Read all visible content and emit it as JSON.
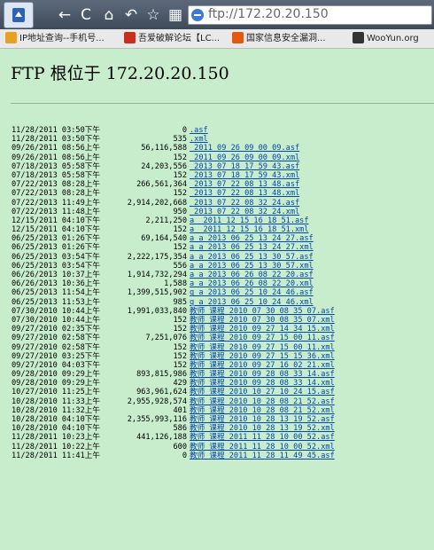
{
  "toolbar": {
    "back": "←",
    "reload": "C",
    "home": "⌂",
    "undo": "↶",
    "favorite": "☆",
    "apps": "▦",
    "url": "ftp://172.20.20.150"
  },
  "bookmarks": [
    {
      "label": "IP地址查询--手机号...",
      "color": "#e8a020"
    },
    {
      "label": "吾爱破解论坛【LC...",
      "color": "#c8301c"
    },
    {
      "label": "国家信息安全漏洞...",
      "color": "#e05a10"
    },
    {
      "label": "WooYun.org",
      "color": "#333333"
    }
  ],
  "heading": "FTP 根位于 172.20.20.150",
  "entries": [
    {
      "date": "11/28/2011 03:50下午",
      "size": "0",
      "name": ".asf"
    },
    {
      "date": "11/28/2011 03:50下午",
      "size": "535",
      "name": ".xml"
    },
    {
      "date": "09/26/2011 08:56上午",
      "size": "56,116,588",
      "name": "_2011_09_26_09_00_09.asf"
    },
    {
      "date": "09/26/2011 08:56上午",
      "size": "152",
      "name": "_2011_09_26_09_00_09.xml"
    },
    {
      "date": "07/18/2013 05:58下午",
      "size": "24,203,556",
      "name": "_2013_07_18_17_59_43.asf"
    },
    {
      "date": "07/18/2013 05:58下午",
      "size": "152",
      "name": "_2013_07_18_17_59_43.xml"
    },
    {
      "date": "07/22/2013 08:28上午",
      "size": "266,561,364",
      "name": "_2013_07_22_08_13_48.asf"
    },
    {
      "date": "07/22/2013 08:28上午",
      "size": "152",
      "name": "_2013_07_22_08_13_48.xml"
    },
    {
      "date": "07/22/2013 11:49上午",
      "size": "2,914,202,668",
      "name": "_2013_07_22_08_32_24.asf"
    },
    {
      "date": "07/22/2013 11:48上午",
      "size": "950",
      "name": "_2013_07_22_08_32_24.xml"
    },
    {
      "date": "12/15/2011 04:10下午",
      "size": "2,211,250",
      "name": "a__2011_12_15_16_18_51.asf"
    },
    {
      "date": "12/15/2011 04:10下午",
      "size": "152",
      "name": "a__2011_12_15_16_18_51.xml"
    },
    {
      "date": "06/25/2013 01:26下午",
      "size": "69,164,540",
      "name": "a_a_2013_06_25_13_24_27.asf"
    },
    {
      "date": "06/25/2013 01:26下午",
      "size": "152",
      "name": "a_a_2013_06_25_13_24_27.xml"
    },
    {
      "date": "06/25/2013 03:54下午",
      "size": "2,222,175,354",
      "name": "a_a_2013_06_25_13_30_57.asf"
    },
    {
      "date": "06/25/2013 03:54下午",
      "size": "556",
      "name": "a_a_2013_06_25_13_30_57.xml"
    },
    {
      "date": "06/26/2013 10:37上午",
      "size": "1,914,732,294",
      "name": "a_a_2013_06_26_08_22_20.asf"
    },
    {
      "date": "06/26/2013 10:36上午",
      "size": "1,588",
      "name": "a_a_2013_06_26_08_22_20.xml"
    },
    {
      "date": "06/25/2013 11:54上午",
      "size": "1,399,515,902",
      "name": "q_a_2013_06_25_10_24_46.asf"
    },
    {
      "date": "06/25/2013 11:53上午",
      "size": "985",
      "name": "q_a_2013_06_25_10_24_46.xml"
    },
    {
      "date": "07/30/2010 10:44上午",
      "size": "1,991,033,840",
      "name": "教师_课程_2010_07_30_08_35_07.asf"
    },
    {
      "date": "07/30/2010 10:44上午",
      "size": "152",
      "name": "教师_课程_2010_07_30_08_35_07.xml"
    },
    {
      "date": "09/27/2010 02:35下午",
      "size": "152",
      "name": "教师_课程_2010_09_27_14_34_15.xml"
    },
    {
      "date": "09/27/2010 02:58下午",
      "size": "7,251,076",
      "name": "教师_课程_2010_09_27_15_00_11.asf"
    },
    {
      "date": "09/27/2010 02:58下午",
      "size": "152",
      "name": "教师_课程_2010_09_27_15_00_11.xml"
    },
    {
      "date": "09/27/2010 03:25下午",
      "size": "152",
      "name": "教师_课程_2010_09_27_15_15_36.xml"
    },
    {
      "date": "09/27/2010 04:03下午",
      "size": "152",
      "name": "教师_课程_2010_09_27_16_02_21.xml"
    },
    {
      "date": "09/28/2010 09:29上午",
      "size": "893,815,986",
      "name": "教师_课程_2010_09_28_08_33_14.asf"
    },
    {
      "date": "09/28/2010 09:29上午",
      "size": "429",
      "name": "教师_课程_2010_09_28_08_33_14.xml"
    },
    {
      "date": "10/27/2010 11:25上午",
      "size": "963,961,624",
      "name": "教师_课程_2010_10_27_10_24_15.asf"
    },
    {
      "date": "10/28/2010 11:33上午",
      "size": "2,955,928,574",
      "name": "教师_课程_2010_10_28_08_21_52.asf"
    },
    {
      "date": "10/28/2010 11:32上午",
      "size": "401",
      "name": "教师_课程_2010_10_28_08_21_52.xml"
    },
    {
      "date": "10/28/2010 04:10下午",
      "size": "2,355,993,116",
      "name": "教师_课程_2010_10_28_13_19_52.asf"
    },
    {
      "date": "10/28/2010 04:10下午",
      "size": "586",
      "name": "教师_课程_2010_10_28_13_19_52.xml"
    },
    {
      "date": "11/28/2011 10:23上午",
      "size": "441,126,188",
      "name": "教师_课程_2011_11_28_10_00_52.asf"
    },
    {
      "date": "11/28/2011 10:22上午",
      "size": "600",
      "name": "教师_课程_2011_11_28_10_00_52.xml"
    },
    {
      "date": "11/28/2011 11:41上午",
      "size": "0",
      "name": "教师_课程_2011_11_28_11_49_45.asf"
    }
  ]
}
